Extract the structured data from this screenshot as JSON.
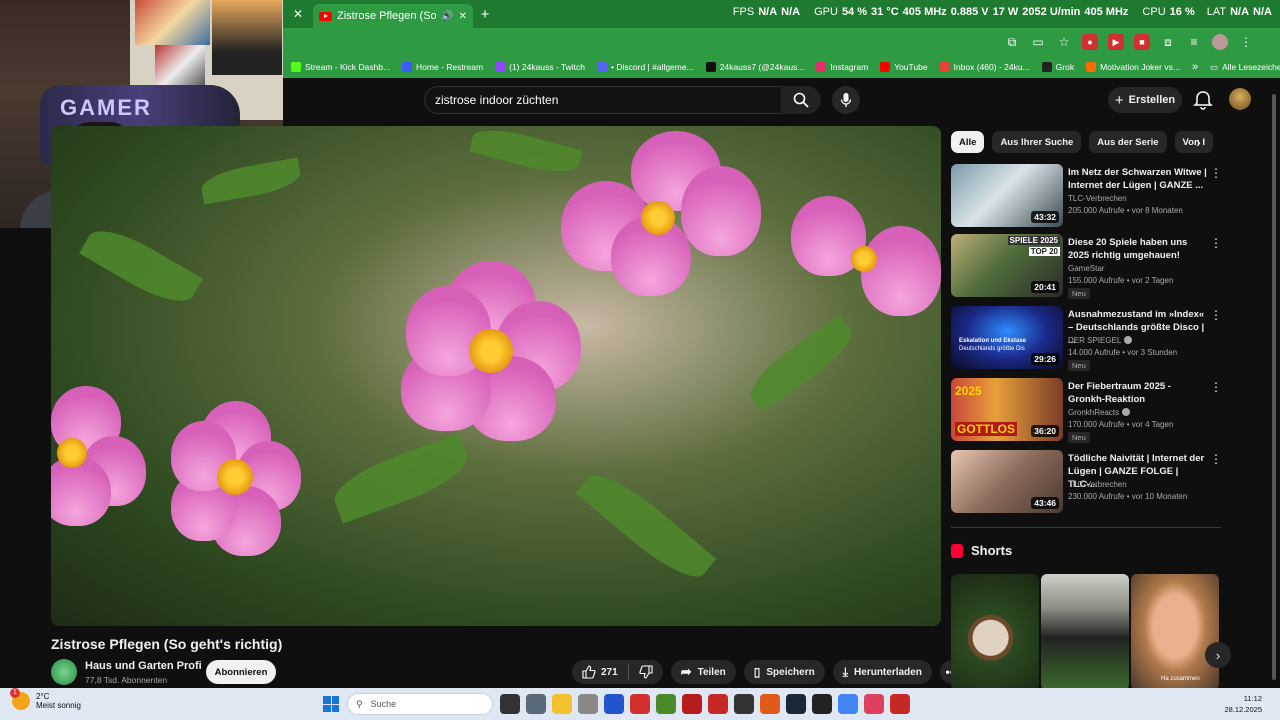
{
  "browser": {
    "tab_title": "Zistrose Pflegen (So geht's",
    "overlay": {
      "fps_label": "FPS",
      "fps_value": "N/A",
      "fps_value2": "N/A",
      "gpu_label": "GPU",
      "gpu_usage": "54 %",
      "gpu_temp": "31 °C",
      "gpu_clock": "405 MHz",
      "gpu_volt": "0.885 V",
      "gpu_power": "17 W",
      "gpu_fan": "2052 U/min",
      "gpu_mem": "405 MHz",
      "cpu_label": "CPU",
      "cpu_usage": "16 %",
      "lat_label": "LAT",
      "lat_value": "N/A",
      "lat_value2": "N/A"
    },
    "bookmarks": [
      {
        "label": "Stream - Kick Dashb...",
        "color": "#53fc18"
      },
      {
        "label": "Home - Restream",
        "color": "#3d5afe"
      },
      {
        "label": "(1) 24kauss - Twitch",
        "color": "#9146ff"
      },
      {
        "label": "• Discord | #allgeme...",
        "color": "#5865f2"
      },
      {
        "label": "24kauss7 (@24kaus...",
        "color": "#111111"
      },
      {
        "label": "Instagram",
        "color": "#e1306c"
      },
      {
        "label": "YouTube",
        "color": "#ff0000"
      },
      {
        "label": "Inbox (460) - 24ku...",
        "color": "#ea4335"
      },
      {
        "label": "Grok",
        "color": "#222222"
      },
      {
        "label": "Motivation Joker vs...",
        "color": "#ff6a00"
      }
    ],
    "bookmarks_all": "Alle Lesezeichen"
  },
  "header": {
    "search_value": "zistrose indoor züchten",
    "create_label": "Erstellen"
  },
  "video": {
    "title": "Zistrose Pflegen (So geht's richtig)",
    "channel_name": "Haus und Garten Profi",
    "channel_subs": "77,8 Tsd. Abonnenten",
    "subscribe_label": "Abonnieren",
    "likes": "271",
    "share_label": "Teilen",
    "save_label": "Speichern",
    "download_label": "Herunterladen"
  },
  "chips": [
    "Alle",
    "Aus Ihrer Suche",
    "Aus der Serie",
    "Von I"
  ],
  "recommendations": [
    {
      "title": "Im Netz der Schwarzen Witwe | Internet der Lügen | GANZE ...",
      "channel": "TLC-Verbrechen",
      "meta": "205.000 Aufrufe • vor 8 Monaten",
      "duration": "43:32",
      "new": "",
      "verified": false
    },
    {
      "title": "Diese 20 Spiele haben uns 2025 richtig umgehauen!",
      "channel": "GameStar",
      "meta": "155.000 Aufrufe • vor 2 Tagen",
      "duration": "20:41",
      "new": "Neu",
      "verified": false
    },
    {
      "title": "Ausnahmezustand im »Index« – Deutschlands größte Disco | ...",
      "channel": "DER SPIEGEL",
      "meta": "14.000 Aufrufe • vor 3 Stunden",
      "duration": "29:26",
      "new": "Neu",
      "verified": true
    },
    {
      "title": "Der Fiebertraum 2025 - Gronkh-Reaktion",
      "channel": "GronkhReacts",
      "meta": "170.000 Aufrufe • vor 4 Tagen",
      "duration": "36:20",
      "new": "Neu",
      "verified": true
    },
    {
      "title": "Tödliche Naivität | Internet der Lügen | GANZE FOLGE | TLC-...",
      "channel": "TLC-Verbrechen",
      "meta": "230.000 Aufrufe • vor 10 Monaten",
      "duration": "43:46",
      "new": "",
      "verified": false
    }
  ],
  "thumb_texts": {
    "spiele": "SPIELE 2025",
    "top20": "TOP 20",
    "disco": "Eskalation und Ekstase",
    "disco2": "Deutschlands größte Dis",
    "gottlos": "GOTTLOS",
    "year": "2025"
  },
  "shorts": {
    "label": "Shorts",
    "caption": "Ha zusammen"
  },
  "webcam": {
    "blanket_text": "GAMER"
  },
  "taskbar": {
    "temp": "2°C",
    "weather": "Meist sonnig",
    "badge": "1",
    "search_placeholder": "Suche",
    "time": "11:12",
    "date": "28.12.2025"
  }
}
